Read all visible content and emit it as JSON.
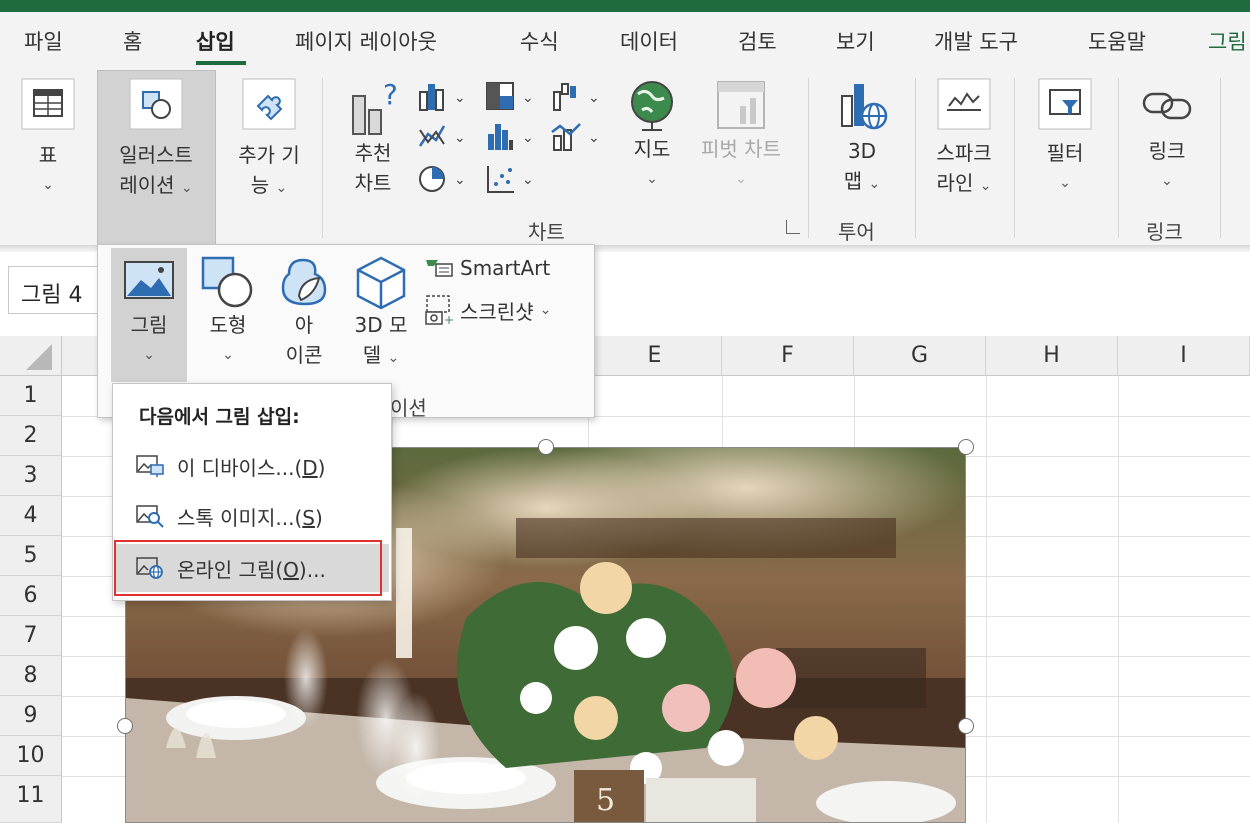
{
  "tabs": [
    "파일",
    "홈",
    "삽입",
    "페이지 레이아웃",
    "수식",
    "데이터",
    "검토",
    "보기",
    "개발 도구",
    "도움말",
    "그림"
  ],
  "ribbon": {
    "table": {
      "label": "표"
    },
    "illustrations": {
      "line1": "일러스트",
      "line2": "레이션"
    },
    "addins": {
      "line1": "추가 기",
      "line2": "능"
    },
    "recommended_charts": {
      "line1": "추천",
      "line2": "차트"
    },
    "map": {
      "label": "지도"
    },
    "pivot_chart": {
      "label": "피벗 차트"
    },
    "map3d": {
      "line1": "3D",
      "line2": "맵"
    },
    "sparkline": {
      "line1": "스파크",
      "line2": "라인"
    },
    "filter": {
      "label": "필터"
    },
    "link": {
      "label": "링크"
    },
    "groups": {
      "chart": "차트",
      "tour": "투어",
      "link": "링크"
    }
  },
  "namebox": "그림 4",
  "illus_panel": {
    "picture": "그림",
    "shapes": "도형",
    "icons_line1": "아",
    "icons_line2": "이콘",
    "model3d_line1": "3D 모",
    "model3d_line2": "델",
    "smartart": "SmartArt",
    "screenshot": "스크린샷",
    "group_label": "이션"
  },
  "picture_menu": {
    "header": "다음에서 그림 삽입:",
    "items": [
      {
        "text": "이 디바이스...",
        "key": "D"
      },
      {
        "text": "스톡 이미지...",
        "key": "S"
      },
      {
        "text": "온라인 그림",
        "key": "O",
        "suffix": "..."
      }
    ]
  },
  "columns": [
    "E",
    "F",
    "G",
    "H",
    "I"
  ],
  "rows": [
    "1",
    "2",
    "3",
    "4",
    "5",
    "6",
    "7",
    "8",
    "9",
    "10",
    "11"
  ],
  "colors": {
    "accent": "#1e6b3f",
    "highlight_box": "#e03030"
  }
}
